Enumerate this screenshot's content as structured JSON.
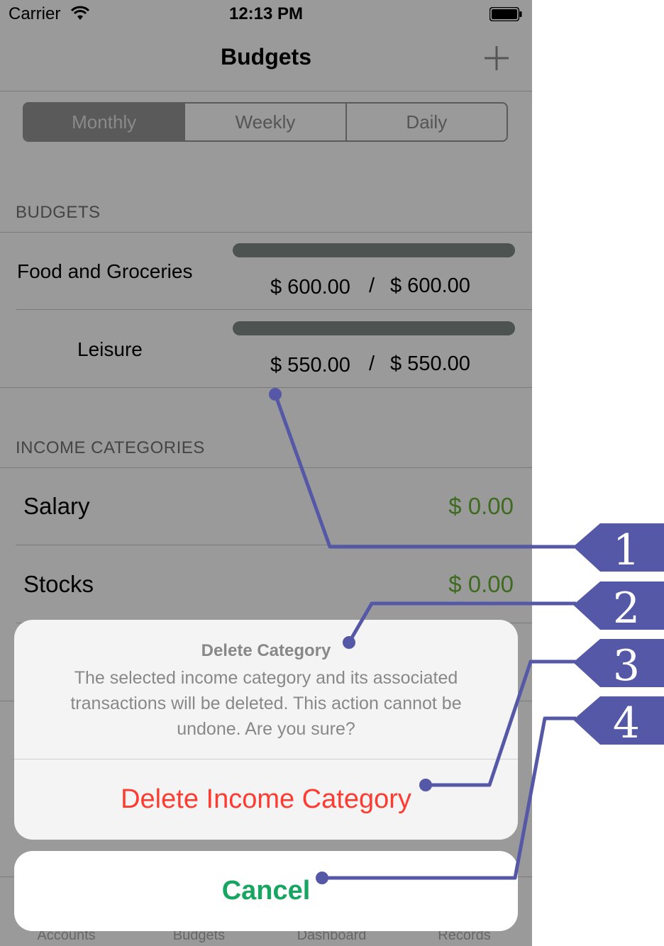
{
  "status_bar": {
    "carrier": "Carrier",
    "time": "12:13 PM"
  },
  "nav": {
    "title": "Budgets",
    "add_icon": "plus-icon"
  },
  "segments": [
    "Monthly",
    "Weekly",
    "Daily"
  ],
  "budgets": {
    "header": "BUDGETS",
    "items": [
      {
        "name": "Food and Groceries",
        "spent": "$ 600.00",
        "sep": "/",
        "limit": "$ 600.00",
        "progress": 1.0
      },
      {
        "name": "Leisure",
        "spent": "$ 550.00",
        "sep": "/",
        "limit": "$ 550.00",
        "progress": 1.0
      }
    ]
  },
  "income": {
    "header": "INCOME CATEGORIES",
    "items": [
      {
        "name": "Salary",
        "value": "$ 0.00"
      },
      {
        "name": "Stocks",
        "value": "$ 0.00"
      }
    ]
  },
  "tabs": [
    "Accounts",
    "Budgets",
    "Dashboard",
    "Records"
  ],
  "action_sheet": {
    "title": "Delete Category",
    "message": "The selected income category and its associated transactions will be deleted. This action cannot be undone. Are you sure?",
    "destructive": "Delete Income Category",
    "cancel": "Cancel"
  },
  "callouts": [
    "1",
    "2",
    "3",
    "4"
  ],
  "colors": {
    "callout": "#5558a6",
    "destructive": "#ff3b30",
    "cancel": "#17a562",
    "income_value": "#3e6b1f"
  }
}
